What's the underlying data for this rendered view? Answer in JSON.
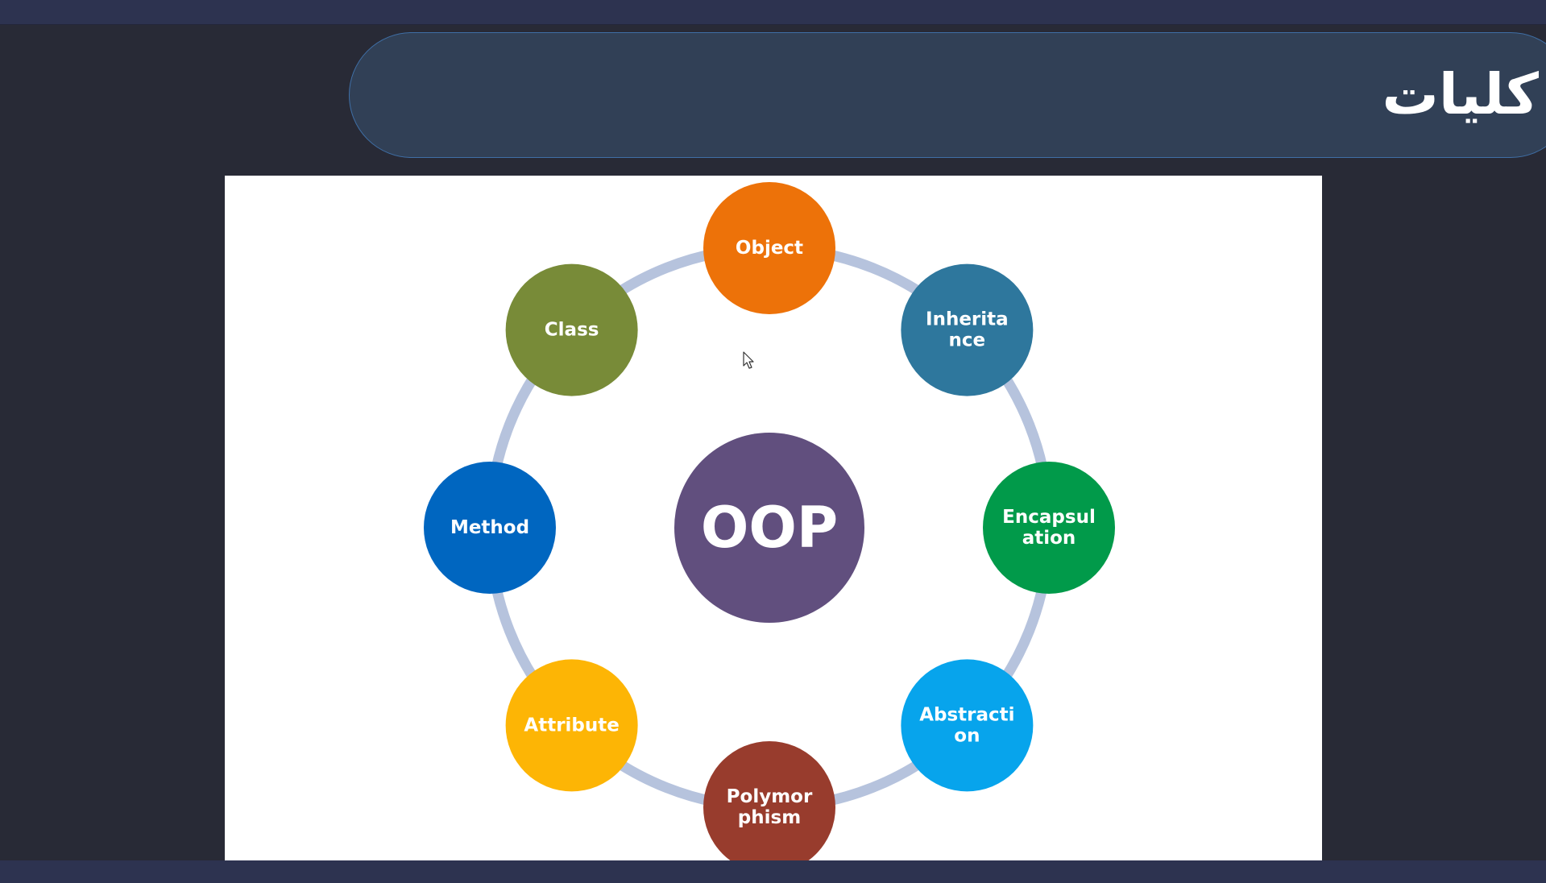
{
  "header": {
    "title": "كليات"
  },
  "diagram": {
    "center": {
      "label": "OOP",
      "color": "#614f7e"
    },
    "ring_color": "#b6c3dd",
    "nodes": [
      {
        "id": "object",
        "lines": [
          "Object"
        ],
        "color": "#ed7209"
      },
      {
        "id": "inheritance",
        "lines": [
          "Inherita",
          "nce"
        ],
        "color": "#2e779d"
      },
      {
        "id": "encapsulation",
        "lines": [
          "Encapsul",
          "ation"
        ],
        "color": "#019a4a"
      },
      {
        "id": "abstraction",
        "lines": [
          "Abstracti",
          "on"
        ],
        "color": "#07a4ec"
      },
      {
        "id": "polymorphism",
        "lines": [
          "Polymor",
          "phism"
        ],
        "color": "#983c2d"
      },
      {
        "id": "attribute",
        "lines": [
          "Attribute"
        ],
        "color": "#fdb505"
      },
      {
        "id": "method",
        "lines": [
          "Method"
        ],
        "color": "#0066c0"
      },
      {
        "id": "class",
        "lines": [
          "Class"
        ],
        "color": "#788b38"
      }
    ]
  }
}
